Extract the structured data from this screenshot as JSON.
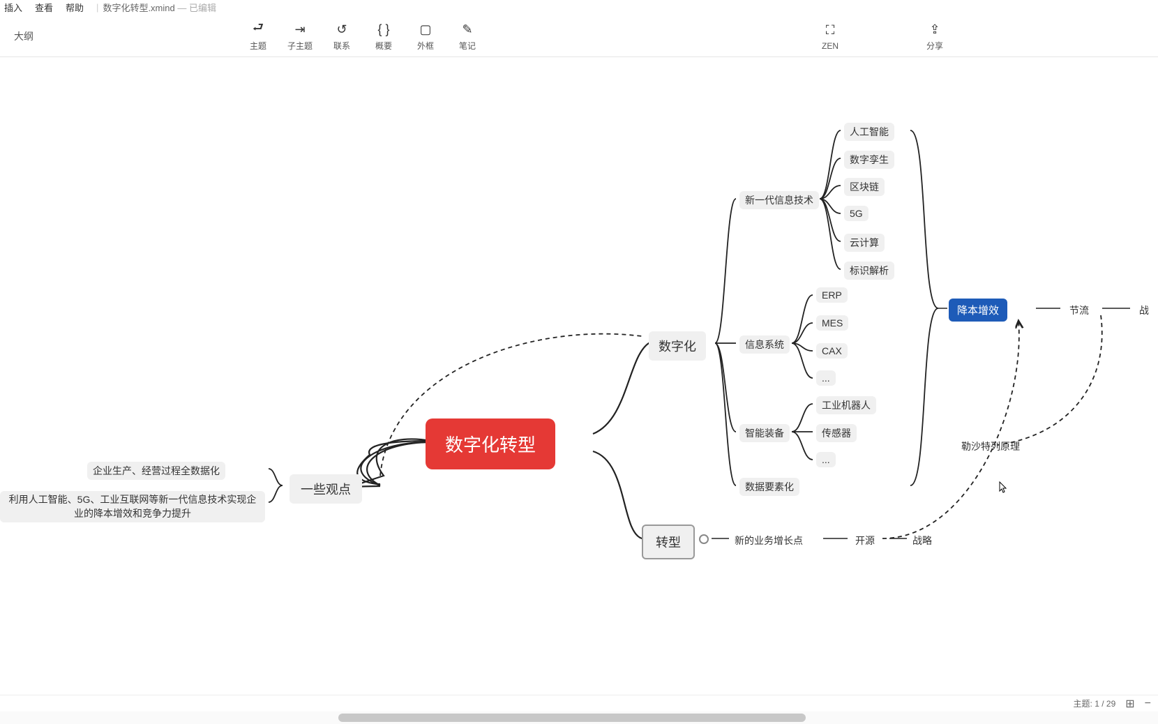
{
  "menu": {
    "insert": "插入",
    "view": "查看",
    "help": "帮助",
    "filename": "数字化转型.xmind",
    "state": "— 已编辑"
  },
  "outline": "大纲",
  "tools": {
    "topic": "主题",
    "subtopic": "子主题",
    "relation": "联系",
    "summary": "概要",
    "boundary": "外框",
    "note": "笔记",
    "zen": "ZEN",
    "share": "分享"
  },
  "nodes": {
    "root": "数字化转型",
    "views": "一些观点",
    "v1": "企业生产、经营过程全数据化",
    "v2": "利用人工智能、5G、工业互联网等新一代信息技术实现企业的降本增效和竞争力提升",
    "digital": "数字化",
    "transform": "转型",
    "newtech": "新一代信息技术",
    "t1": "人工智能",
    "t2": "数字孪生",
    "t3": "区块链",
    "t4": "5G",
    "t5": "云计算",
    "t6": "标识解析",
    "infosys": "信息系统",
    "s1": "ERP",
    "s2": "MES",
    "s3": "CAX",
    "s4": "...",
    "smarteq": "智能装备",
    "e1": "工业机器人",
    "e2": "传感器",
    "e3": "...",
    "dataelem": "数据要素化",
    "cost": "降本增效",
    "jieliu": "节流",
    "zhan": "战",
    "principle": "勒沙特列原理",
    "newbiz": "新的业务增长点",
    "kaiyuan": "开源",
    "zhanlue": "战略"
  },
  "status": {
    "topic_label": "主题:",
    "topic_count": "1 / 29",
    "minus": "−"
  }
}
